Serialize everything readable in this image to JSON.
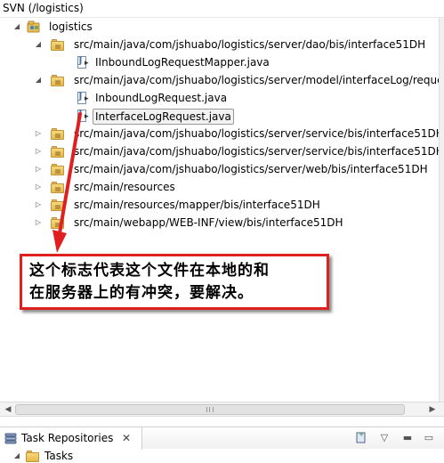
{
  "window": {
    "title": "SVN (/logistics)"
  },
  "tree": {
    "root": {
      "label": "logistics"
    },
    "items": [
      {
        "label": "src/main/java/com/jshuabo/logistics/server/dao/bis/interface51DH",
        "kind": "folder",
        "expanded": true
      },
      {
        "label": "IInboundLogRequestMapper.java",
        "kind": "java"
      },
      {
        "label": "src/main/java/com/jshuabo/logistics/server/model/interfaceLog/reque",
        "kind": "folder",
        "expanded": true
      },
      {
        "label": "InboundLogRequest.java",
        "kind": "java"
      },
      {
        "label": "InterfaceLogRequest.java",
        "kind": "java",
        "selected": true
      },
      {
        "label": "src/main/java/com/jshuabo/logistics/server/service/bis/interface51DH",
        "kind": "folder",
        "expanded": false
      },
      {
        "label": "src/main/java/com/jshuabo/logistics/server/service/bis/interface51DH/",
        "kind": "folder",
        "expanded": false
      },
      {
        "label": "src/main/java/com/jshuabo/logistics/server/web/bis/interface51DH",
        "kind": "folder",
        "expanded": false
      },
      {
        "label": "src/main/resources",
        "kind": "folder",
        "expanded": false
      },
      {
        "label": "src/main/resources/mapper/bis/interface51DH",
        "kind": "folder",
        "expanded": false
      },
      {
        "label": "src/main/webapp/WEB-INF/view/bis/interface51DH",
        "kind": "folder",
        "expanded": false
      }
    ]
  },
  "annotation": {
    "line1": "这个标志代表这个文件在本地的和",
    "line2": "在服务器上的有冲突，要解决。",
    "color": "#e02020"
  },
  "task_panel": {
    "tab_label": "Task Repositories",
    "close_symbol": "✕",
    "tasks_label": "Tasks"
  },
  "icons": {
    "expanded": "expand-triangle-icon",
    "collapsed": "collapse-triangle-icon",
    "folder": "package-folder-icon",
    "java": "java-file-conflict-icon"
  }
}
